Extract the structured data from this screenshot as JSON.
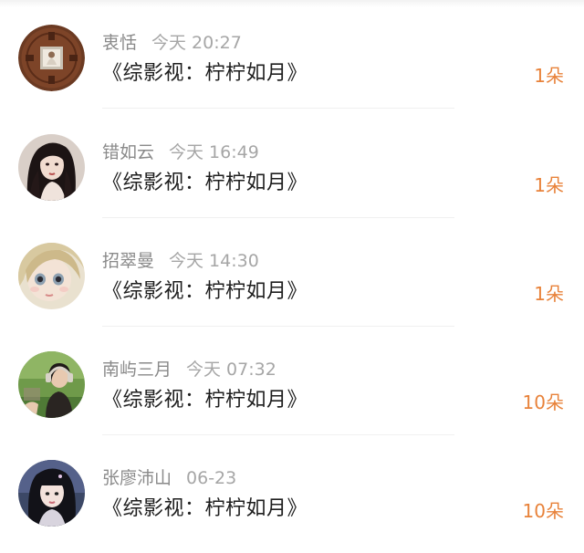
{
  "gift_list": {
    "items": [
      {
        "user_name": "衷恬",
        "time": "今天 20:27",
        "work_title": "《综影视：柠柠如月》",
        "count": "1朵",
        "avatar_icon": "coin-avatar"
      },
      {
        "user_name": "错如云",
        "time": "今天 16:49",
        "work_title": "《综影视：柠柠如月》",
        "count": "1朵",
        "avatar_icon": "girl-portrait-avatar"
      },
      {
        "user_name": "招翠曼",
        "time": "今天 14:30",
        "work_title": "《综影视：柠柠如月》",
        "count": "1朵",
        "avatar_icon": "doll-face-avatar"
      },
      {
        "user_name": "南屿三月",
        "time": "今天 07:32",
        "work_title": "《综影视：柠柠如月》",
        "count": "10朵",
        "avatar_icon": "girl-headphones-avatar"
      },
      {
        "user_name": "张廖沛山",
        "time": "06-23",
        "work_title": "《综影视：柠柠如月》",
        "count": "10朵",
        "avatar_icon": "girl-bangs-avatar"
      }
    ]
  },
  "colors": {
    "accent": "#e8823a",
    "meta_text": "#9a9a9a",
    "title_text": "#1e1e1e"
  }
}
